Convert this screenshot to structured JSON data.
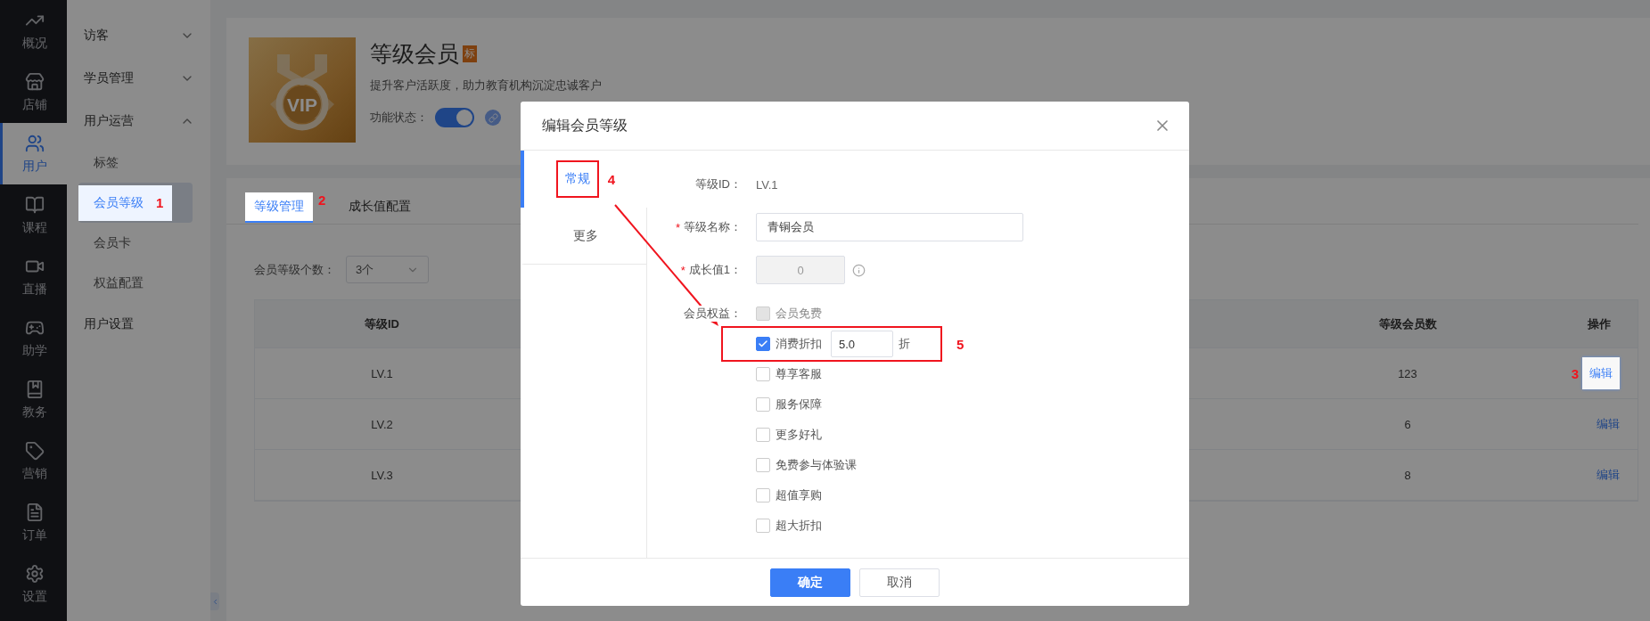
{
  "rail": [
    {
      "label": "概况",
      "selected": false
    },
    {
      "label": "店铺",
      "selected": false
    },
    {
      "label": "用户",
      "selected": true
    },
    {
      "label": "课程",
      "selected": false
    },
    {
      "label": "直播",
      "selected": false
    },
    {
      "label": "助学",
      "selected": false
    },
    {
      "label": "教务",
      "selected": false
    },
    {
      "label": "营销",
      "selected": false
    },
    {
      "label": "订单",
      "selected": false
    },
    {
      "label": "设置",
      "selected": false
    }
  ],
  "submenu": [
    {
      "kind": "group",
      "label": "访客",
      "expanded": false
    },
    {
      "kind": "group",
      "label": "学员管理",
      "expanded": false
    },
    {
      "kind": "group",
      "label": "用户运营",
      "expanded": true,
      "children": [
        {
          "label": "标签",
          "selected": false,
          "highlighted": false
        },
        {
          "label": "会员等级",
          "selected": true,
          "highlighted": true,
          "annotation": "1"
        },
        {
          "label": "会员卡",
          "selected": false,
          "highlighted": false
        },
        {
          "label": "权益配置",
          "selected": false,
          "highlighted": false
        }
      ]
    },
    {
      "kind": "link",
      "label": "用户设置"
    }
  ],
  "header": {
    "logo_text": "VIP",
    "title": "等级会员",
    "badge": "标",
    "description": "提升客户活跃度，助力教育机构沉淀忠诚客户",
    "status_label": "功能状态：",
    "status_on": true
  },
  "tabs": [
    {
      "label": "等级管理",
      "selected": true,
      "highlighted": true,
      "annotation": "2"
    },
    {
      "label": "成长值配置",
      "selected": false,
      "highlighted": false
    }
  ],
  "level_count": {
    "label": "会员等级个数：",
    "value": "3个"
  },
  "table": {
    "columns": [
      "等级ID",
      "等级会员数",
      "操作"
    ],
    "rows": [
      {
        "level": "LV.1",
        "members": "123",
        "action": "编辑",
        "highlighted": true,
        "annotation": "3"
      },
      {
        "level": "LV.2",
        "members": "6",
        "action": "编辑",
        "highlighted": false
      },
      {
        "level": "LV.3",
        "members": "8",
        "action": "编辑",
        "highlighted": false
      }
    ]
  },
  "dialog": {
    "title": "编辑会员等级",
    "tabs": [
      {
        "label": "常规",
        "selected": true,
        "annotation": "4"
      },
      {
        "label": "更多",
        "selected": false
      }
    ],
    "fields": [
      {
        "kind": "text",
        "label": "等级ID：",
        "value": "LV.1"
      },
      {
        "kind": "input",
        "required_mark": "*",
        "label": "等级名称：",
        "value": "青铜会员",
        "disabled": false
      },
      {
        "kind": "input",
        "required_mark": "*",
        "label": "成长值1：",
        "value": "0",
        "disabled": true
      }
    ],
    "benefits_label": "会员权益：",
    "benefits": [
      {
        "label": "会员免费",
        "checked": false,
        "disabled": true
      },
      {
        "label": "消费折扣",
        "checked": true,
        "disabled": false,
        "input": "5.0",
        "unit": "折",
        "annotation": "5"
      },
      {
        "label": "尊享客服",
        "checked": false,
        "disabled": false
      },
      {
        "label": "服务保障",
        "checked": false,
        "disabled": false
      },
      {
        "label": "更多好礼",
        "checked": false,
        "disabled": false
      },
      {
        "label": "免费参与体验课",
        "checked": false,
        "disabled": false
      },
      {
        "label": "超值享购",
        "checked": false,
        "disabled": false
      },
      {
        "label": "超大折扣",
        "checked": false,
        "disabled": false
      }
    ],
    "buttons": [
      {
        "label": "确定",
        "kind": "primary"
      },
      {
        "label": "取消",
        "kind": "default"
      }
    ]
  }
}
